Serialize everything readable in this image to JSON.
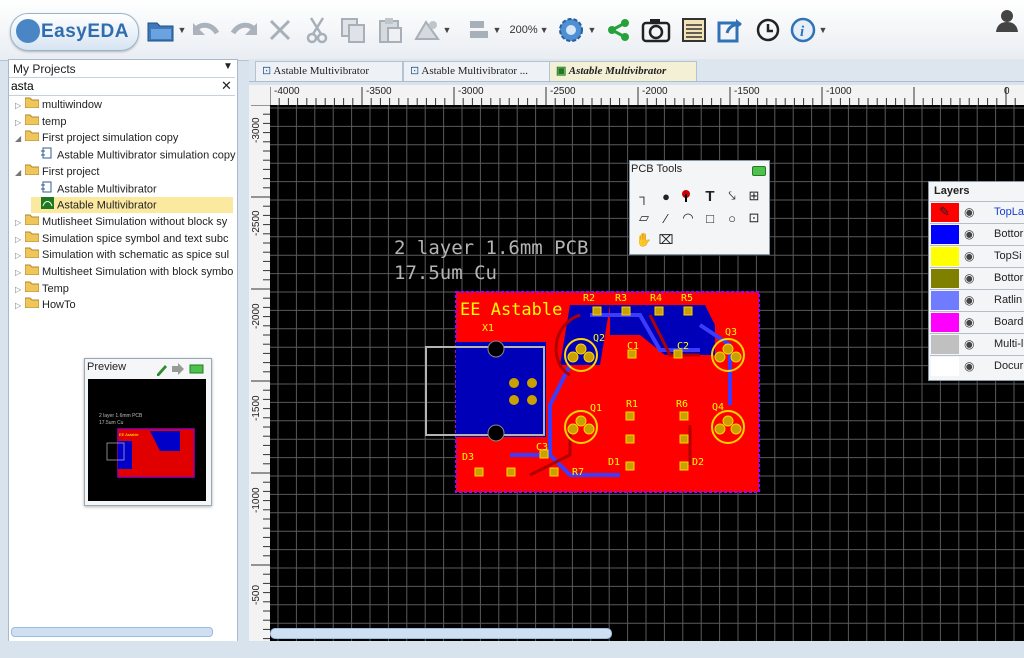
{
  "app": {
    "logo_text": "EasyEDA"
  },
  "toolbar": {
    "zoom": "200%",
    "icons": [
      "folder-icon",
      "undo-icon",
      "redo-icon",
      "delete-icon",
      "cut-icon",
      "copy-icon",
      "paste-icon",
      "route-icon",
      "align-icon",
      "settings-icon",
      "share-icon",
      "camera-icon",
      "bom-icon",
      "export-icon",
      "history-icon",
      "info-icon",
      "user-icon"
    ]
  },
  "left_panel": {
    "project_select": "My Projects",
    "search_value": "asta",
    "tree": [
      {
        "label": "multiwindow",
        "type": "folder",
        "indent": 0
      },
      {
        "label": "temp",
        "type": "folder",
        "indent": 0
      },
      {
        "label": "First project simulation copy",
        "type": "folder-open",
        "indent": 0
      },
      {
        "label": "Astable Multivibrator simulation copy",
        "type": "schematic",
        "indent": 1
      },
      {
        "label": "First project",
        "type": "folder-open",
        "indent": 0
      },
      {
        "label": "Astable Multivibrator",
        "type": "schematic",
        "indent": 1
      },
      {
        "label": "Astable Multivibrator",
        "type": "pcb",
        "indent": 1,
        "selected": true
      },
      {
        "label": "Mutlisheet Simulation without block sy",
        "type": "folder",
        "indent": 0
      },
      {
        "label": "Simulation spice symbol and text subc",
        "type": "folder",
        "indent": 0
      },
      {
        "label": "Simulation with schematic as spice sul",
        "type": "folder",
        "indent": 0
      },
      {
        "label": "Multisheet Simulation with block symbo",
        "type": "folder",
        "indent": 0
      },
      {
        "label": "Temp",
        "type": "folder",
        "indent": 0
      },
      {
        "label": "HowTo",
        "type": "folder",
        "indent": 0
      }
    ]
  },
  "preview": {
    "title": "Preview",
    "line1": "2 layer 1.6mm PCB",
    "line2": "17.5um Cu",
    "board_label": "EE Astable"
  },
  "tabs": [
    {
      "label": "Astable Multivibrator",
      "active": false
    },
    {
      "label": "Astable Multivibrator ...",
      "active": false
    },
    {
      "label": "Astable Multivibrator",
      "active": true
    }
  ],
  "rulers": {
    "h_labels": [
      "-4000",
      "-3500",
      "-3000",
      "-2500",
      "-2000",
      "-1500",
      "-1000",
      "0"
    ],
    "v_labels": [
      "-3000",
      "-2500",
      "-2000",
      "-1500",
      "-1000",
      "-500"
    ]
  },
  "pcb": {
    "note_line1": "2 layer 1.6mm PCB",
    "note_line2": "17.5um Cu",
    "board_title": "EE Astable",
    "designators": [
      "X1",
      "R2",
      "R3",
      "R4",
      "R5",
      "Q2",
      "Q3",
      "C1",
      "C2",
      "Q1",
      "R1",
      "R6",
      "Q4",
      "C3",
      "D3",
      "R7",
      "D1",
      "D2"
    ]
  },
  "pcb_tools": {
    "title": "PCB Tools"
  },
  "layers": {
    "title": "Layers",
    "rows": [
      {
        "name": "TopLa",
        "color": "#ff0000",
        "active": true
      },
      {
        "name": "Bottor",
        "color": "#0000ff"
      },
      {
        "name": "TopSi",
        "color": "#ffff00"
      },
      {
        "name": "Bottor",
        "color": "#808000"
      },
      {
        "name": "Ratlin",
        "color": "#6f7cff"
      },
      {
        "name": "Board",
        "color": "#ff00ff"
      },
      {
        "name": "Multi-l",
        "color": "#c0c0c0"
      },
      {
        "name": "Docur",
        "color": "#ffffff"
      }
    ]
  },
  "colors": {
    "top_layer": "#ff0000",
    "bottom_layer": "#0000ff",
    "silk": "#ffff00",
    "pad": "#c8a000",
    "grid": "#5a5a5a"
  }
}
